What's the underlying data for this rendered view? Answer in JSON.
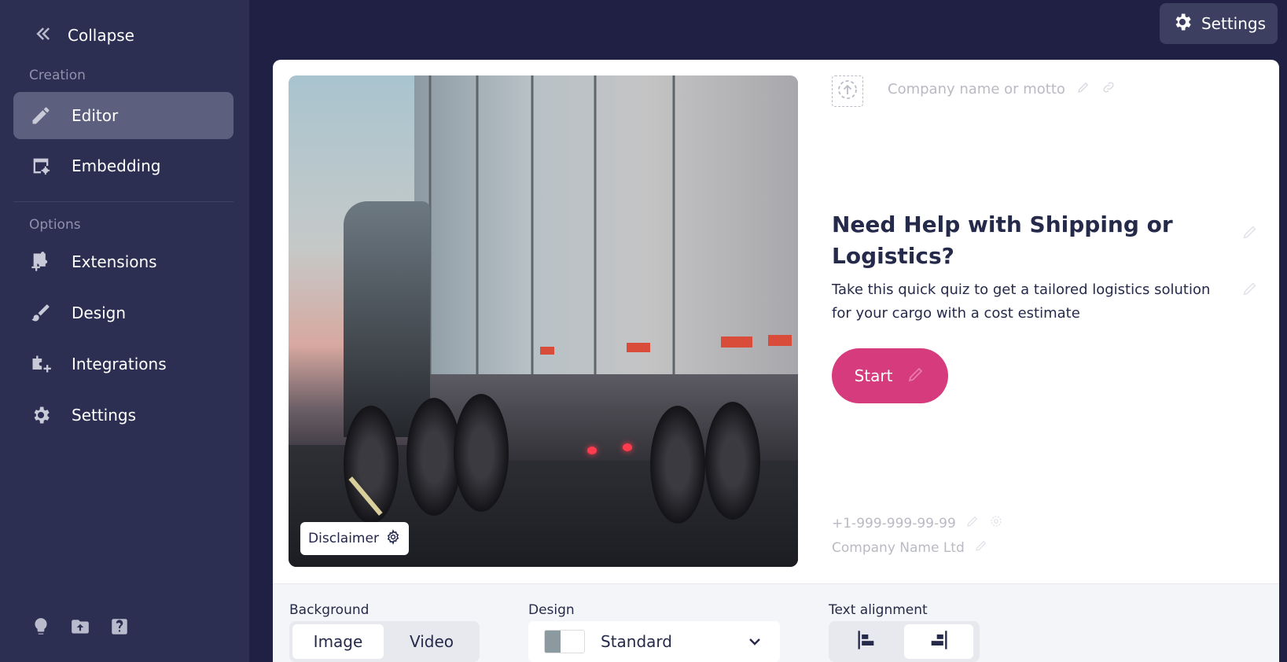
{
  "sidebar": {
    "collapse_label": "Collapse",
    "sections": [
      {
        "label": "Creation"
      },
      {
        "label": "Options"
      }
    ],
    "items": [
      {
        "label": "Editor",
        "icon": "pencil-icon",
        "active": true
      },
      {
        "label": "Embedding",
        "icon": "embed-gear-icon"
      },
      {
        "label": "Extensions",
        "icon": "puzzle-icon"
      },
      {
        "label": "Design",
        "icon": "brush-icon"
      },
      {
        "label": "Integrations",
        "icon": "integration-icon"
      },
      {
        "label": "Settings",
        "icon": "gear-icon"
      }
    ],
    "footer_icons": [
      "lightbulb-icon",
      "folder-upload-icon",
      "help-icon"
    ]
  },
  "header": {
    "settings_label": "Settings"
  },
  "editor": {
    "disclaimer_label": "Disclaimer",
    "motto_placeholder": "Company name or motto",
    "headline": "Need Help with Shipping or Logistics?",
    "subtext": "Take this quick quiz to get a tailored logistics solution for your cargo with a cost estimate",
    "start_label": "Start",
    "phone": "+1-999-999-99-99",
    "company_name": "Company Name Ltd",
    "accent_color": "#d63b7d"
  },
  "controls": {
    "background_label": "Background",
    "background_options": [
      "Image",
      "Video"
    ],
    "background_selected": "Image",
    "design_label": "Design",
    "design_value": "Standard",
    "alignment_label": "Text alignment",
    "alignment_options": [
      "align-left-icon",
      "align-right-icon"
    ],
    "alignment_selected": "align-right-icon"
  }
}
